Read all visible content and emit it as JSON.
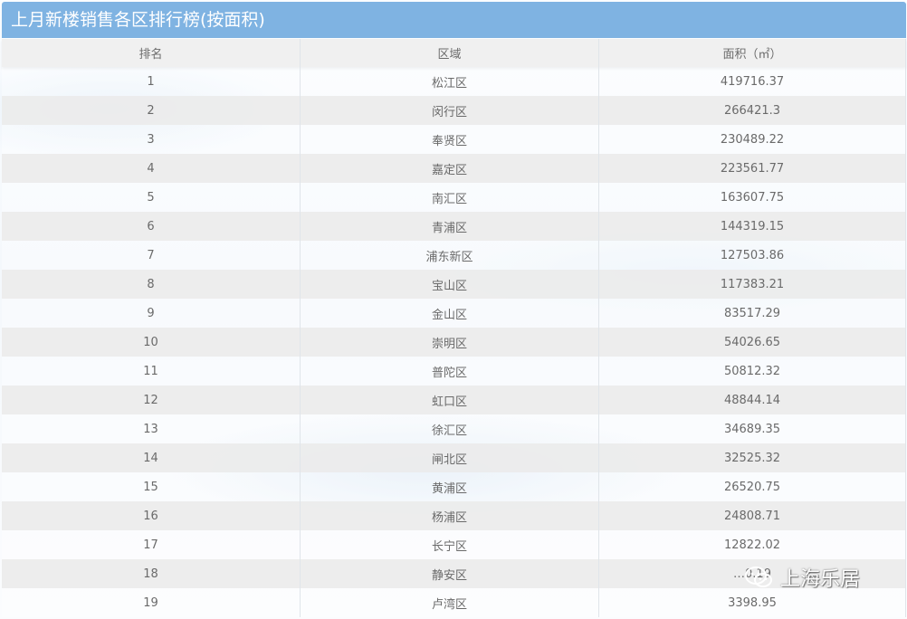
{
  "title": "上月新楼销售各区排行榜(按面积)",
  "columns": [
    "排名",
    "区域",
    "面积（㎡）"
  ],
  "rows": [
    {
      "rank": "1",
      "district": "松江区",
      "area": "419716.37"
    },
    {
      "rank": "2",
      "district": "闵行区",
      "area": "266421.3"
    },
    {
      "rank": "3",
      "district": "奉贤区",
      "area": "230489.22"
    },
    {
      "rank": "4",
      "district": "嘉定区",
      "area": "223561.77"
    },
    {
      "rank": "5",
      "district": "南汇区",
      "area": "163607.75"
    },
    {
      "rank": "6",
      "district": "青浦区",
      "area": "144319.15"
    },
    {
      "rank": "7",
      "district": "浦东新区",
      "area": "127503.86"
    },
    {
      "rank": "8",
      "district": "宝山区",
      "area": "117383.21"
    },
    {
      "rank": "9",
      "district": "金山区",
      "area": "83517.29"
    },
    {
      "rank": "10",
      "district": "崇明区",
      "area": "54026.65"
    },
    {
      "rank": "11",
      "district": "普陀区",
      "area": "50812.32"
    },
    {
      "rank": "12",
      "district": "虹口区",
      "area": "48844.14"
    },
    {
      "rank": "13",
      "district": "徐汇区",
      "area": "34689.35"
    },
    {
      "rank": "14",
      "district": "闸北区",
      "area": "32525.32"
    },
    {
      "rank": "15",
      "district": "黄浦区",
      "area": "26520.75"
    },
    {
      "rank": "16",
      "district": "杨浦区",
      "area": "24808.71"
    },
    {
      "rank": "17",
      "district": "长宁区",
      "area": "12822.02"
    },
    {
      "rank": "18",
      "district": "静安区",
      "area": "…0.19"
    },
    {
      "rank": "19",
      "district": "卢湾区",
      "area": "3398.95"
    }
  ],
  "watermark": {
    "text": "上海乐居",
    "icon": "wechat-icon"
  }
}
